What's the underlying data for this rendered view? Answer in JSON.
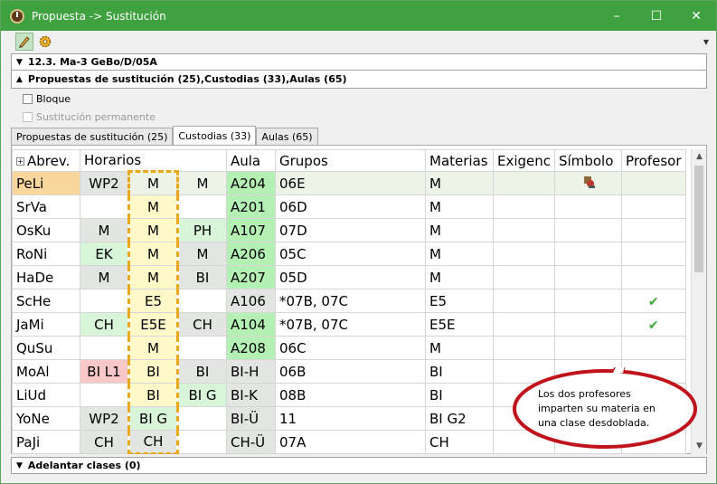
{
  "window": {
    "title": "Propuesta -> Sustitución",
    "controls": [
      "–",
      "☐",
      "✕"
    ]
  },
  "sections": {
    "lesson": "12.3. Ma-3 GeBo/D/05A",
    "proposals": "Propuestas de sustitución (25),Custodias (33),Aulas (65)",
    "bottom": "Adelantar clases (0)"
  },
  "options": {
    "block": "Bloque",
    "permanent": "Sustitución permanente"
  },
  "tabs": [
    {
      "label": "Propuestas de sustitución (25)",
      "active": false
    },
    {
      "label": "Custodias (33)",
      "active": true
    },
    {
      "label": "Aulas (65)",
      "active": false
    }
  ],
  "columns": {
    "abbrev": "Abrev.",
    "schedule": "Horarios",
    "room": "Aula",
    "groups": "Grupos",
    "subjects": "Materias",
    "demand": "Exigenc",
    "symbol": "Símbolo",
    "teacher": "Profesor"
  },
  "rows": [
    {
      "name": "PeLi",
      "h1": "WP2",
      "h2": "M",
      "h3": "M",
      "room": "A204",
      "groups": "06E",
      "subjects": "M"
    },
    {
      "name": "SrVa",
      "h1": "",
      "h2": "M",
      "h3": "",
      "room": "A201",
      "groups": "06D",
      "subjects": "M"
    },
    {
      "name": "OsKu",
      "h1": "M",
      "h2": "M",
      "h3": "PH",
      "room": "A107",
      "groups": "07D",
      "subjects": "M"
    },
    {
      "name": "RoNi",
      "h1": "EK",
      "h2": "M",
      "h3": "M",
      "room": "A206",
      "groups": "05C",
      "subjects": "M"
    },
    {
      "name": "HaDe",
      "h1": "M",
      "h2": "M",
      "h3": "BI",
      "room": "A207",
      "groups": "05D",
      "subjects": "M"
    },
    {
      "name": "ScHe",
      "h1": "",
      "h2": "E5",
      "h3": "",
      "room": "A106",
      "groups": "*07B, 07C",
      "subjects": "E5"
    },
    {
      "name": "JaMi",
      "h1": "CH",
      "h2": "E5E",
      "h3": "CH",
      "room": "A104",
      "groups": "*07B, 07C",
      "subjects": "E5E"
    },
    {
      "name": "QuSu",
      "h1": "",
      "h2": "M",
      "h3": "",
      "room": "A208",
      "groups": "06C",
      "subjects": "M"
    },
    {
      "name": "MoAl",
      "h1": "BI L1",
      "h2": "BI",
      "h3": "BI",
      "room": "BI-H",
      "groups": "06B",
      "subjects": "BI"
    },
    {
      "name": "LiUd",
      "h1": "",
      "h2": "BI",
      "h3": "BI G",
      "room": "BI-K",
      "groups": "08B",
      "subjects": "BI"
    },
    {
      "name": "YoNe",
      "h1": "WP2",
      "h2": "BI G",
      "h3": "",
      "room": "BI-Ü",
      "groups": "11",
      "subjects": "BI G2"
    },
    {
      "name": "PaJi",
      "h1": "CH",
      "h2": "CH",
      "h3": "",
      "room": "CH-Ü",
      "groups": "07A",
      "subjects": "CH"
    }
  ],
  "callout": {
    "text": "Los dos profesores imparten su materia en una clase desdoblada."
  },
  "icons": {
    "checkmark": "✔"
  },
  "colors": {
    "titlebar": "#3fa13f",
    "room_green": "#b4f0b4",
    "highlight_dash": "#e8a81a"
  }
}
